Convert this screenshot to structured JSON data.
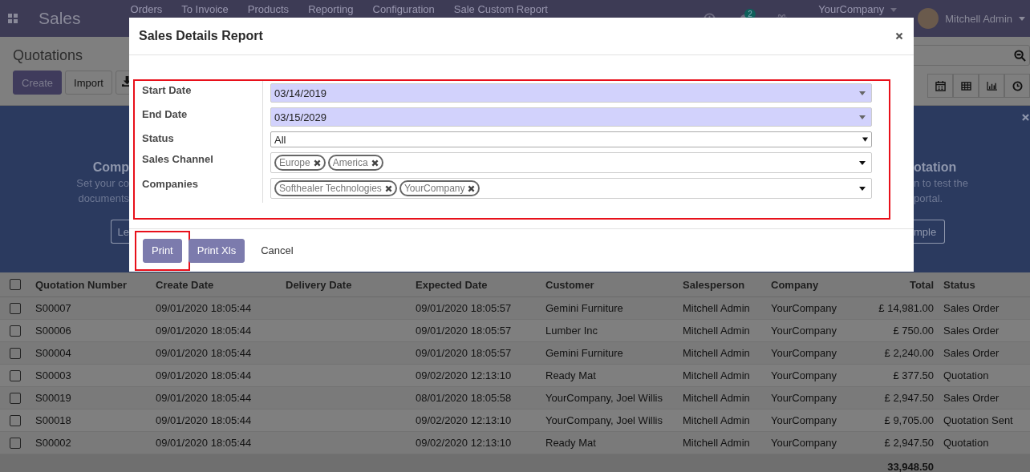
{
  "navbar": {
    "app_title": "Sales",
    "menu": [
      "Orders",
      "To Invoice",
      "Products",
      "Reporting",
      "Configuration",
      "Sale Custom Report"
    ],
    "message_count": "2",
    "company": "YourCompany",
    "user": "Mitchell Admin"
  },
  "control_panel": {
    "title": "Quotations",
    "buttons": [
      {
        "label": "Create",
        "kind": "primary"
      },
      {
        "label": "Import",
        "kind": "secondary"
      }
    ]
  },
  "banner": {
    "left": {
      "title": "Comp",
      "lines": [
        "Set your co",
        "documents"
      ],
      "button": "Le"
    },
    "right": {
      "title": "otation",
      "lines": [
        "n to test the",
        "portal."
      ],
      "button": "mple"
    }
  },
  "dialog": {
    "title": "Sales Details Report",
    "fields_highlighted": true,
    "fields": [
      {
        "label": "Start Date",
        "kind": "date",
        "value": "03/14/2019"
      },
      {
        "label": "End Date",
        "kind": "date",
        "value": "03/15/2029"
      },
      {
        "label": "Status",
        "kind": "select",
        "value": "All"
      },
      {
        "label": "Sales Channel",
        "kind": "tags",
        "tags": [
          "Europe",
          "America"
        ]
      },
      {
        "label": "Companies",
        "kind": "tags",
        "tags": [
          "Softhealer Technologies",
          "YourCompany"
        ]
      }
    ],
    "buttons": [
      {
        "label": "Print",
        "kind": "primary",
        "highlighted": true
      },
      {
        "label": "Print Xls",
        "kind": "primary",
        "highlighted": false
      },
      {
        "label": "Cancel",
        "kind": "link",
        "highlighted": false
      }
    ]
  },
  "table": {
    "columns": [
      "Quotation Number",
      "Create Date",
      "Delivery Date",
      "Expected Date",
      "Customer",
      "Salesperson",
      "Company",
      "Total",
      "Status"
    ],
    "rows": [
      {
        "checked": false,
        "cells": [
          "S00007",
          "09/01/2020 18:05:44",
          "",
          "09/01/2020 18:05:57",
          "Gemini Furniture",
          "Mitchell Admin",
          "YourCompany",
          "£ 14,981.00",
          "Sales Order"
        ]
      },
      {
        "checked": false,
        "cells": [
          "S00006",
          "09/01/2020 18:05:44",
          "",
          "09/01/2020 18:05:57",
          "Lumber Inc",
          "Mitchell Admin",
          "YourCompany",
          "£ 750.00",
          "Sales Order"
        ]
      },
      {
        "checked": false,
        "cells": [
          "S00004",
          "09/01/2020 18:05:44",
          "",
          "09/01/2020 18:05:57",
          "Gemini Furniture",
          "Mitchell Admin",
          "YourCompany",
          "£ 2,240.00",
          "Sales Order"
        ]
      },
      {
        "checked": false,
        "cells": [
          "S00003",
          "09/01/2020 18:05:44",
          "",
          "09/02/2020 12:13:10",
          "Ready Mat",
          "Mitchell Admin",
          "YourCompany",
          "£ 377.50",
          "Quotation"
        ]
      },
      {
        "checked": false,
        "cells": [
          "S00019",
          "09/01/2020 18:05:44",
          "",
          "08/01/2020 18:05:58",
          "YourCompany, Joel Willis",
          "Mitchell Admin",
          "YourCompany",
          "£ 2,947.50",
          "Sales Order"
        ]
      },
      {
        "checked": false,
        "cells": [
          "S00018",
          "09/01/2020 18:05:44",
          "",
          "09/02/2020 12:13:10",
          "YourCompany, Joel Willis",
          "Mitchell Admin",
          "YourCompany",
          "£ 9,705.00",
          "Quotation Sent"
        ]
      },
      {
        "checked": false,
        "cells": [
          "S00002",
          "09/01/2020 18:05:44",
          "",
          "09/02/2020 12:13:10",
          "Ready Mat",
          "Mitchell Admin",
          "YourCompany",
          "£ 2,947.50",
          "Quotation"
        ]
      }
    ],
    "total": "33,948.50",
    "all_selected": false
  }
}
